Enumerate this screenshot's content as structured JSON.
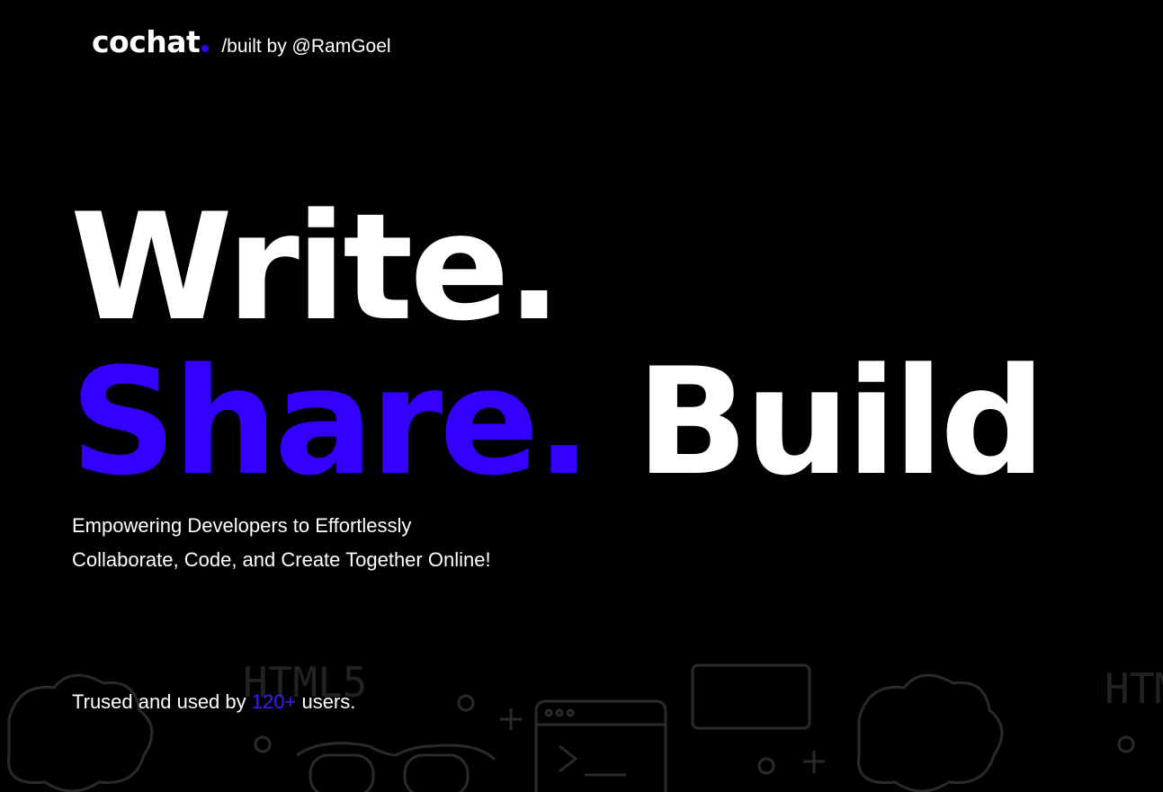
{
  "header": {
    "logo": "cochat",
    "built_by": "/built by @RamGoel"
  },
  "hero": {
    "line1": "Write.",
    "line2_accent": "Share.",
    "line2_rest": "Build"
  },
  "tagline": {
    "line1": "Empowering Developers to Effortlessly",
    "line2": "Collaborate, Code, and Create Together Online!"
  },
  "trusted": {
    "prefix": "Trused and used by",
    "count": "120+",
    "suffix": "users."
  },
  "background": {
    "doodle_text_1": "HTML5",
    "doodle_text_2": "HTM"
  },
  "colors": {
    "background": "#000000",
    "accent": "#3300ff",
    "text": "#ffffff"
  }
}
